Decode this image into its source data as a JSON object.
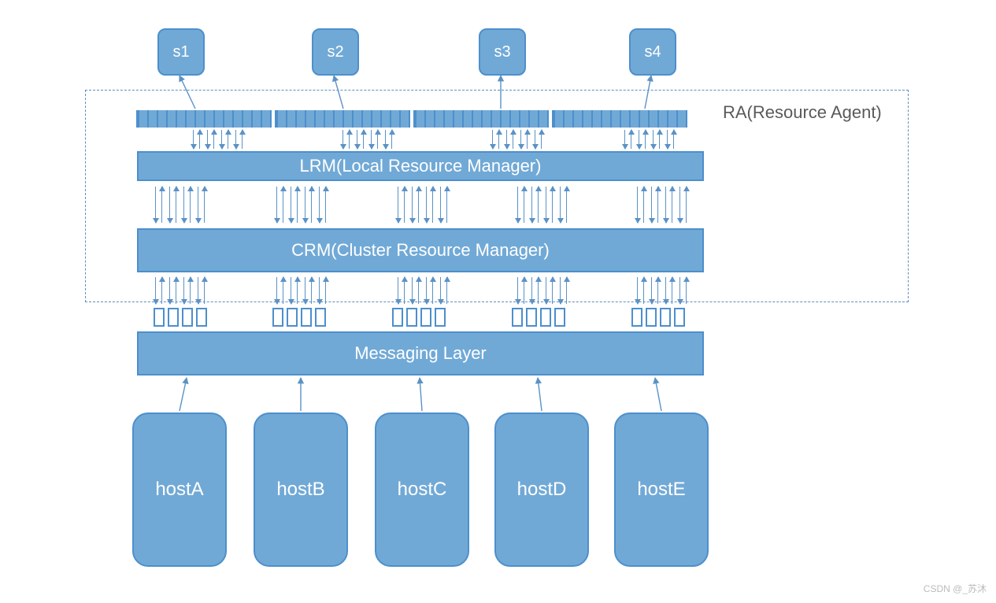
{
  "services": {
    "s1": "s1",
    "s2": "s2",
    "s3": "s3",
    "s4": "s4"
  },
  "ra_label": "RA(Resource Agent)",
  "layers": {
    "lrm": "LRM(Local Resource Manager)",
    "crm": "CRM(Cluster Resource Manager)",
    "msg": "Messaging Layer"
  },
  "hosts": {
    "a": "hostA",
    "b": "hostB",
    "c": "hostC",
    "d": "hostD",
    "e": "hostE"
  },
  "watermark": "CSDN @_苏沐"
}
